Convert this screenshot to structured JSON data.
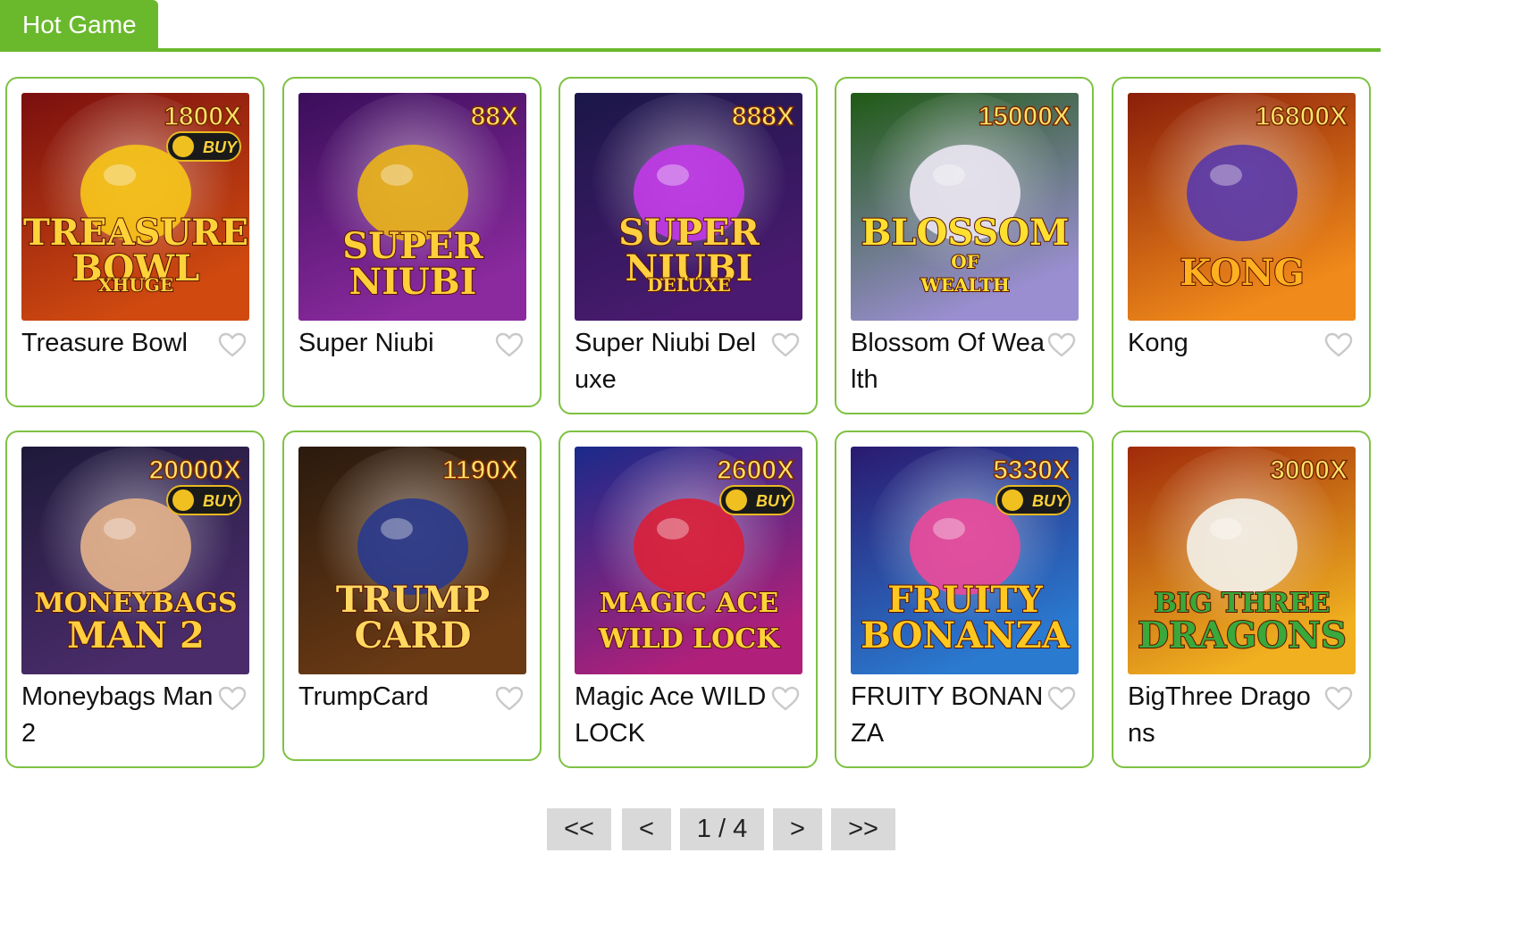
{
  "section": {
    "title": "Hot Game",
    "accent": "#6ab92d"
  },
  "games": [
    {
      "name": "Treasure Bowl",
      "multiplier": "1800X",
      "buy": "BUY",
      "art": [
        "TREASURE",
        "BOWL",
        "XHUGE"
      ],
      "bg1": "#7a0f0f",
      "bg2": "#d04a10",
      "mascot": "#f5c318",
      "text": "#ffd23a"
    },
    {
      "name": "Super Niubi",
      "multiplier": "88X",
      "buy": "",
      "art": [
        "SUPER",
        "NIUBI"
      ],
      "bg1": "#3a0e5a",
      "bg2": "#8a2a9e",
      "mascot": "#e8b21a",
      "text": "#ffcf3a"
    },
    {
      "name": "Super Niubi Deluxe",
      "multiplier": "888X",
      "buy": "",
      "art": [
        "SUPER",
        "NIUBI",
        "DELUXE"
      ],
      "bg1": "#1a1748",
      "bg2": "#4a1a70",
      "mascot": "#c03ae6",
      "text": "#ffd040"
    },
    {
      "name": "Blossom Of Wealth",
      "multiplier": "15000X",
      "buy": "",
      "art": [
        "BLOSSOM",
        "OF",
        "WEALTH"
      ],
      "bg1": "#1f5a14",
      "bg2": "#9a8ed0",
      "mascot": "#e8e4f0",
      "text": "#ffe030"
    },
    {
      "name": "Kong",
      "multiplier": "16800X",
      "buy": "",
      "art": [
        "KONG"
      ],
      "bg1": "#8a1e0a",
      "bg2": "#f08a1a",
      "mascot": "#5a3aa8",
      "text": "#ffb020"
    },
    {
      "name": "Moneybags Man 2",
      "multiplier": "20000X",
      "buy": "BUY",
      "art": [
        "MONEYBAGS",
        "MAN 2"
      ],
      "bg1": "#1e1a3a",
      "bg2": "#4a2c6a",
      "mascot": "#e2b08a",
      "text": "#ffcf40"
    },
    {
      "name": "TrumpCard",
      "multiplier": "1190X",
      "buy": "",
      "art": [
        "TRUMP",
        "CARD"
      ],
      "bg1": "#2a1a0e",
      "bg2": "#6a3a14",
      "mascot": "#2a3a8a",
      "text": "#ffd860"
    },
    {
      "name": "Magic Ace WILD LOCK",
      "multiplier": "2600X",
      "buy": "BUY",
      "art": [
        "MAGIC ACE",
        "WILD LOCK"
      ],
      "bg1": "#1a2a8a",
      "bg2": "#b0207a",
      "mascot": "#d8203a",
      "text": "#ffd23a"
    },
    {
      "name": "FRUITY BONANZA",
      "multiplier": "5330X",
      "buy": "BUY",
      "art": [
        "FRUITY",
        "BONANZA"
      ],
      "bg1": "#2a1a70",
      "bg2": "#2a7ad0",
      "mascot": "#e84a9a",
      "text": "#ffc820"
    },
    {
      "name": "BigThree Dragons",
      "multiplier": "3000X",
      "buy": "",
      "art": [
        "BIG THREE",
        "DRAGONS"
      ],
      "bg1": "#a02a0a",
      "bg2": "#f0b020",
      "mascot": "#f2efe6",
      "text": "#3aa83a"
    }
  ],
  "pagination": {
    "first": "<<",
    "prev": "<",
    "current": "1 / 4",
    "next": ">",
    "last": ">>"
  }
}
